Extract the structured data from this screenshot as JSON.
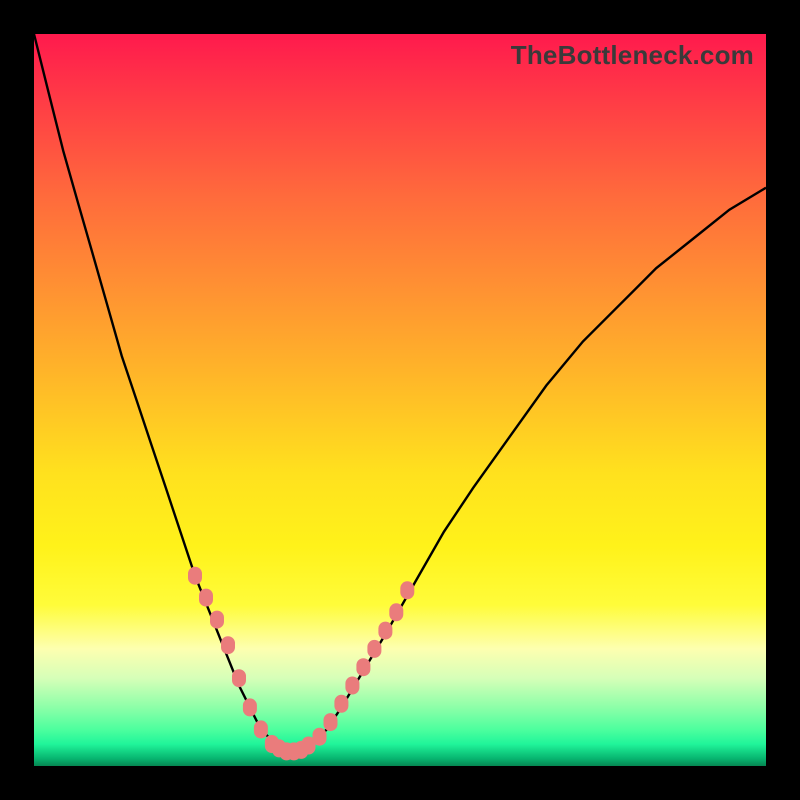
{
  "watermark": "TheBottleneck.com",
  "colors": {
    "frame": "#000000",
    "curve": "#000000",
    "marker": "#ea7c7c",
    "gradient_top": "#ff1a4d",
    "gradient_bottom": "#068752"
  },
  "chart_data": {
    "type": "line",
    "title": "",
    "xlabel": "",
    "ylabel": "",
    "xlim": [
      0,
      100
    ],
    "ylim": [
      0,
      100
    ],
    "grid": false,
    "legend": false,
    "series": [
      {
        "name": "bottleneck-curve",
        "x": [
          0,
          2,
          4,
          6,
          8,
          10,
          12,
          14,
          16,
          18,
          20,
          22,
          24,
          26,
          28,
          30,
          31,
          32,
          33,
          34,
          35,
          36,
          37,
          38,
          40,
          42,
          45,
          48,
          52,
          56,
          60,
          65,
          70,
          75,
          80,
          85,
          90,
          95,
          100
        ],
        "y": [
          100,
          92,
          84,
          77,
          70,
          63,
          56,
          50,
          44,
          38,
          32,
          26,
          21,
          16,
          11,
          7,
          5,
          4,
          3,
          2.3,
          2,
          2,
          2.3,
          3,
          5,
          8,
          13,
          18,
          25,
          32,
          38,
          45,
          52,
          58,
          63,
          68,
          72,
          76,
          79
        ]
      }
    ],
    "markers": {
      "name": "highlight-dots",
      "x": [
        22,
        23.5,
        25,
        26.5,
        28,
        29.5,
        31,
        32.5,
        33.5,
        34.5,
        35.5,
        36.5,
        37.5,
        39,
        40.5,
        42,
        43.5,
        45,
        46.5,
        48,
        49.5,
        51
      ],
      "y": [
        26,
        23,
        20,
        16.5,
        12,
        8,
        5,
        3,
        2.4,
        2,
        2,
        2.2,
        2.8,
        4,
        6,
        8.5,
        11,
        13.5,
        16,
        18.5,
        21,
        24
      ]
    }
  }
}
